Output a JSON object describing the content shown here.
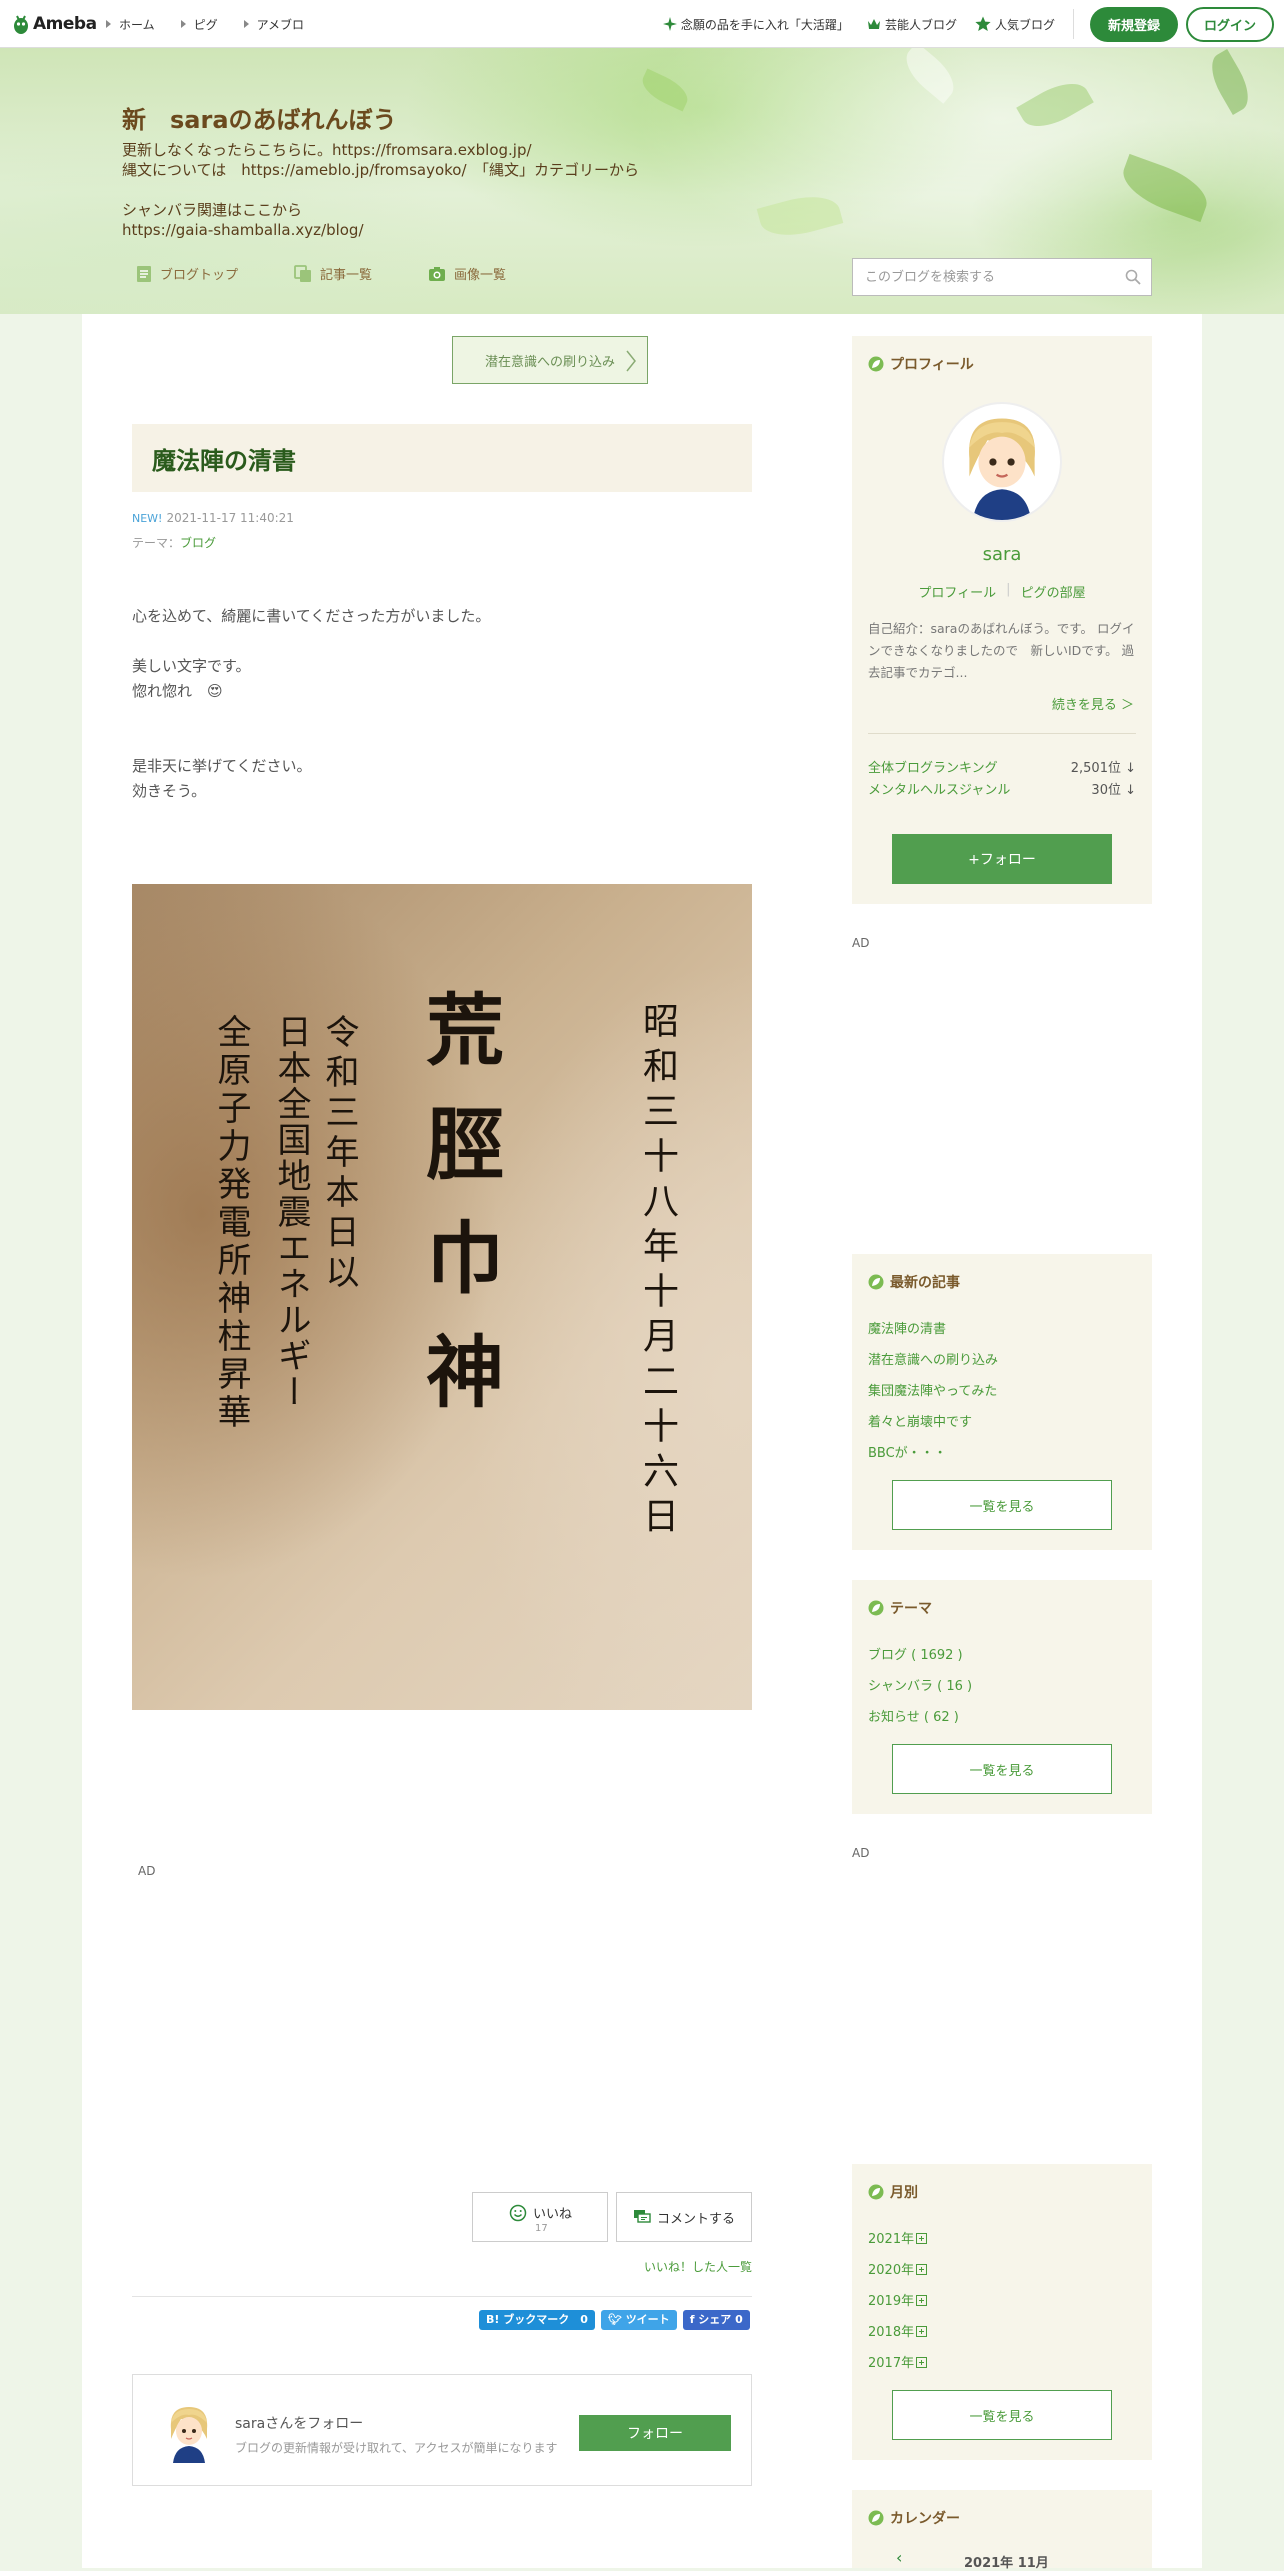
{
  "topbar": {
    "logo": "Ameba",
    "nav_left": [
      "ホーム",
      "ピグ",
      "アメブロ"
    ],
    "nav_right": [
      "念願の品を手に入れ「大活躍」",
      "芸能人ブログ",
      "人気ブログ"
    ],
    "register_label": "新規登録",
    "login_label": "ログイン"
  },
  "header": {
    "title": "新　saraのあばれんぼう",
    "description": "更新しなくなったらこちらに。https://fromsara.exblog.jp/\n縄文については　https://ameblo.jp/fromsayoko/　「縄文」カテゴリーから\n\nシャンバラ関連はここから\nhttps://gaia-shamballa.xyz/blog/",
    "nav": [
      "ブログトップ",
      "記事一覧",
      "画像一覧"
    ],
    "search_placeholder": "このブログを検索する"
  },
  "entry": {
    "reblog_label": "潜在意識への刷り込み",
    "title": "魔法陣の清書",
    "new_badge": "NEW!",
    "datetime": "2021-11-17 11:40:21",
    "theme_prefix": "テーマ：",
    "theme": "ブログ",
    "body": {
      "line1": "心を込めて、綺麗に書いてくださった方がいました。",
      "line2": "美しい文字です。",
      "line3": "惚れ惚れ　😍",
      "line4": "是非天に挙げてください。",
      "line5": "効きそう。"
    },
    "photo_text": {
      "col1": "昭和三十八年十月二十六日",
      "col2": "荒脛巾神",
      "col3": "令和三年本日以",
      "col4": "日本全国地震エネルギー",
      "col5": "全原子力発電所神柱昇華"
    },
    "ad_label": "AD",
    "like_label": "いいね",
    "like_count": "17",
    "comment_label": "コメントする",
    "likers_link": "いいね！した人一覧",
    "share": {
      "bookmark": "B! ブックマーク　0",
      "tweet": "ツイート",
      "facebook": "f シェア 0"
    },
    "follow_card": {
      "title": "saraさんをフォロー",
      "subtitle": "ブログの更新情報が受け取れて、アクセスが簡単になります",
      "button": "フォロー"
    }
  },
  "sidebar": {
    "profile": {
      "heading": "プロフィール",
      "name": "sara",
      "link1": "プロフィール",
      "link2": "ピグの部屋",
      "intro": "自己紹介：saraのあばれんぼう。です。 ログインできなくなりましたので　新しいIDです。 過去記事でカテゴ...",
      "more": "続きを見る ＞",
      "rank1_label": "全体ブログランキング",
      "rank1_value": "2,501位 ↓",
      "rank2_label": "メンタルヘルスジャンル",
      "rank2_value": "30位 ↓",
      "follow_button": "+フォロー"
    },
    "ad_label": "AD",
    "latest": {
      "heading": "最新の記事",
      "items": [
        "魔法陣の清書",
        "潜在意識への刷り込み",
        "集団魔法陣やってみた",
        "着々と崩壊中です",
        "BBCが・・・"
      ],
      "button": "一覧を見る"
    },
    "themes": {
      "heading": "テーマ",
      "items": [
        "ブログ ( 1692 )",
        "シャンバラ ( 16 )",
        "お知らせ ( 62 )"
      ],
      "button": "一覧を見る"
    },
    "ad_label2": "AD",
    "monthly": {
      "heading": "月別",
      "items": [
        "2021年",
        "2020年",
        "2019年",
        "2018年",
        "2017年"
      ],
      "button": "一覧を見る"
    },
    "calendar": {
      "heading": "カレンダー",
      "month": "2021年 11月"
    }
  },
  "colors": {
    "brand_green": "#2d8a3a",
    "button_green": "#519e4f",
    "link_green": "#4a9b3a",
    "title_brown": "#6b4a1e",
    "side_bg": "#f7f5ea"
  }
}
